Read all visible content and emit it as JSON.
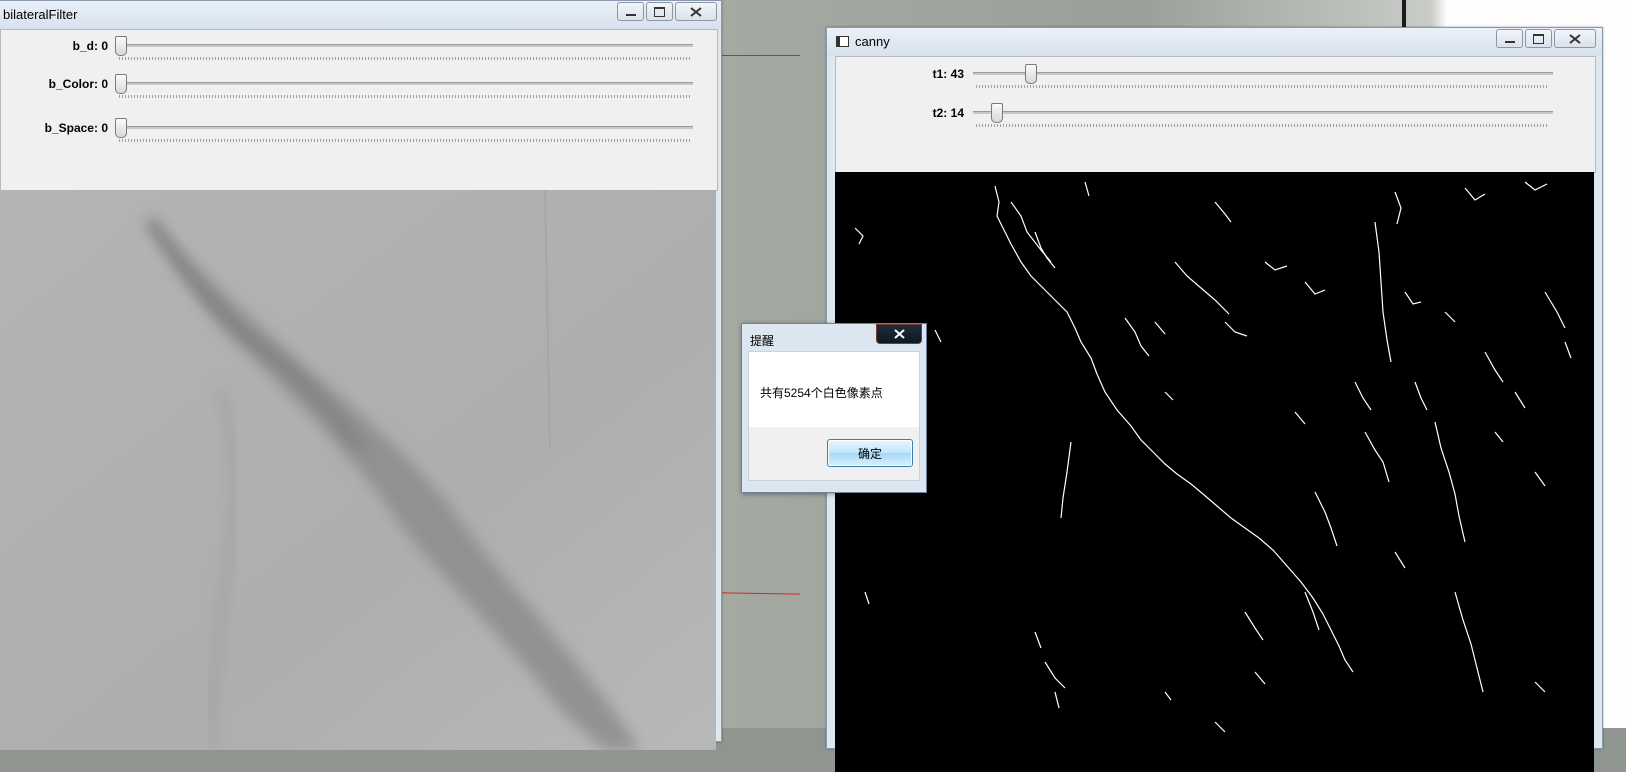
{
  "windows": {
    "bilateral": {
      "title": "bilateralFilter",
      "trackbars": [
        {
          "label": "b_d: 0",
          "value": 0
        },
        {
          "label": "b_Color: 0",
          "value": 0
        },
        {
          "label": "b_Space: 0",
          "value": 0
        }
      ]
    },
    "canny": {
      "title": "canny",
      "trackbars": [
        {
          "label": "t1: 43",
          "value": 43
        },
        {
          "label": "t2: 14",
          "value": 14
        }
      ]
    }
  },
  "dialog": {
    "title": "提醒",
    "message": "共有5254个白色像素点",
    "ok_label": "确定"
  },
  "icons": {
    "minimize": "minimize-icon",
    "maximize": "maximize-icon",
    "close": "close-icon",
    "app": "window-app-icon"
  },
  "colors": {
    "edge": "#ffffff",
    "canvas_bg": "#000000",
    "accent": "#3c7fb1"
  }
}
